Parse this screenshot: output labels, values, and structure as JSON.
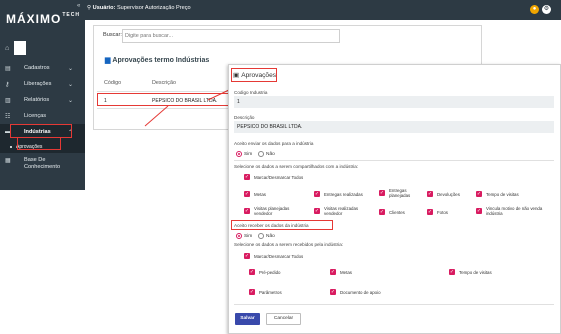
{
  "app": {
    "logo": "MÁXIMO",
    "logo_suffix": "TECH"
  },
  "topbar": {
    "user_label": "Usuário:",
    "user_name": "Supervisor Autorização Preço"
  },
  "sidebar": {
    "items": [
      {
        "label": "Cadastros",
        "icon": "document-icon"
      },
      {
        "label": "Liberações",
        "icon": "key-icon"
      },
      {
        "label": "Relatórios",
        "icon": "chart-icon"
      },
      {
        "label": "Licenças",
        "icon": "license-icon"
      },
      {
        "label": "Indústrias",
        "icon": "factory-icon"
      },
      {
        "label": "Base De Conhecimento",
        "icon": "book-icon"
      }
    ],
    "subitem": "Aprovações"
  },
  "main": {
    "search_label": "Buscar:",
    "search_placeholder": "Digite para buscar...",
    "title": "Aprovações termo Indústrias",
    "columns": [
      "Código",
      "Descrição"
    ],
    "rows": [
      {
        "code": "1",
        "desc": "PEPSICO DO BRASIL LTDA."
      }
    ]
  },
  "modal": {
    "title": "Aprovações",
    "field_code_label": "Codigo Industria",
    "field_code_value": "1",
    "field_desc_label": "Descrição",
    "field_desc_value": "PEPSICO DO BRASIL LTDA.",
    "send_label": "Aceito enviar os dados para a indústria",
    "yes": "Sim",
    "no": "Não",
    "send_select_label": "Selecione os dados a serem compartilhados com a indústria:",
    "select_all": "Marcar/Desmarcar Todos",
    "send_items": [
      "Metas",
      "Entregas realizadas",
      "Entregas planejadas",
      "Devoluções",
      "Tempo de visitas",
      "Visitas planejadas vendedor",
      "Visitas realizadas vendedor",
      "Clientes",
      "Fotos",
      "Vincula motivo de não venda indústria"
    ],
    "receive_label": "Aceito receber os dados da indústria",
    "receive_select_label": "Selecione os dados a serem recebidos pela indústria:",
    "receive_items": [
      "Pré-pedido",
      "Metas",
      "Tempo de visitas",
      "Parâmetros",
      "Documento de apoio"
    ],
    "save": "Salvar",
    "cancel": "Cancelar"
  }
}
